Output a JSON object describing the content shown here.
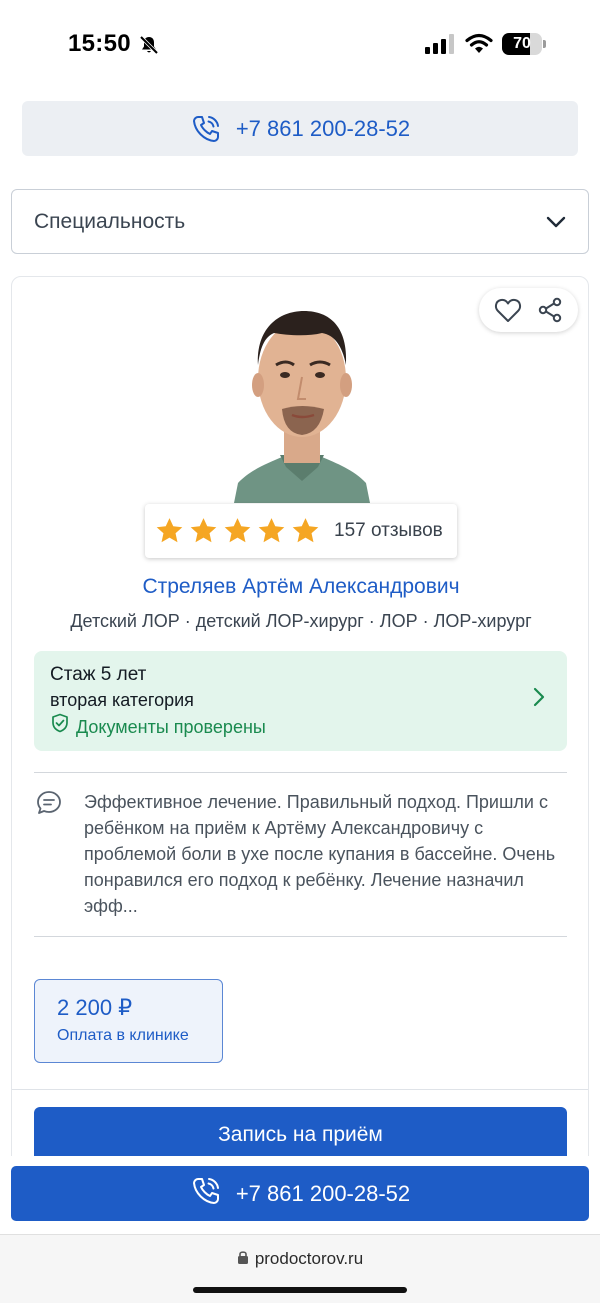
{
  "status_bar": {
    "time": "15:50",
    "battery": "70",
    "battery_level": 0.7
  },
  "top_phone": {
    "number": "+7 861 200-28-52"
  },
  "specialty_select": {
    "label": "Специальность"
  },
  "doctor": {
    "name": "Стреляев Артём Александрович",
    "specialties": "Детский ЛОР · детский ЛОР-хирург · ЛОР · ЛОР-хирург",
    "rating_stars": 5,
    "reviews_count": "157 отзывов",
    "experience": "Стаж 5 лет",
    "category": "вторая категория",
    "documents": "Документы проверены",
    "review": "Эффективное лечение. Правильный подход. Пришли с ребёнком на приём к Артёму Александровичу с проблемой боли в ухе после купания в бассейне. Очень понравился его подход к ребёнку. Лечение назначил эфф...",
    "price": "2 200 ₽",
    "price_note": "Оплата в клинике",
    "book_label": "Запись на приём"
  },
  "bottom_phone": {
    "number": "+7 861 200-28-52"
  },
  "browser": {
    "url": "prodoctorov.ru"
  },
  "colors": {
    "accent": "#1e5cc6",
    "success": "#1a8a4f",
    "success_bg": "#e3f5ec",
    "star": "#f5a623"
  }
}
